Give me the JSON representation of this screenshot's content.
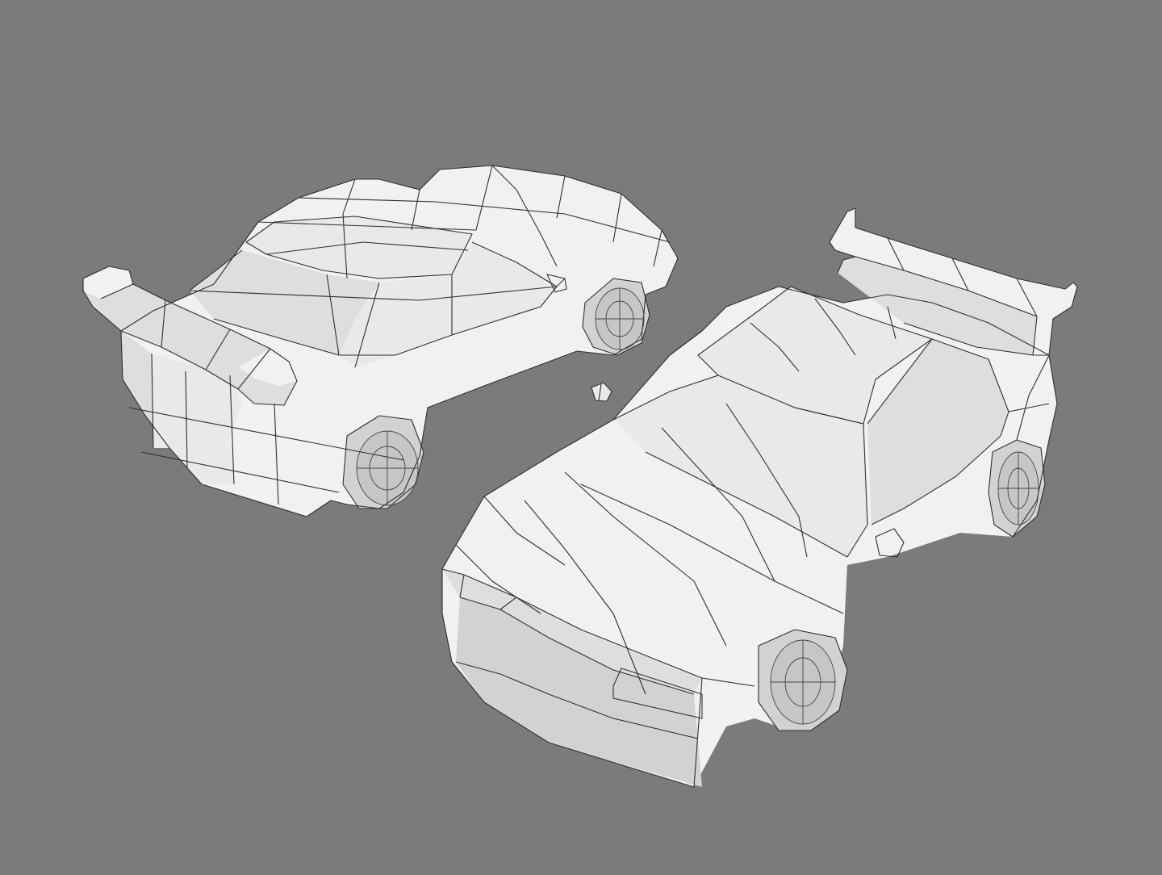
{
  "scene": {
    "background_color": "#7b7b7b",
    "model_color": "#f1f1f1",
    "wire_color": "#2f2f2f"
  },
  "objects": [
    {
      "name": "rear-view-car-wireframe"
    },
    {
      "name": "front-view-car-wireframe"
    }
  ]
}
